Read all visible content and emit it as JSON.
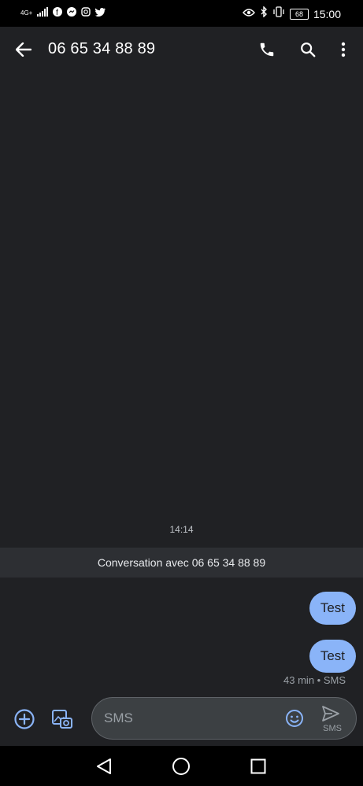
{
  "status_bar": {
    "network": "4G+",
    "time": "15:00",
    "battery": "68",
    "notification_icons": [
      "facebook-icon",
      "messenger-icon",
      "instagram-icon",
      "twitter-icon"
    ]
  },
  "app_bar": {
    "title": "06 65 34 88 89"
  },
  "conversation": {
    "timestamp": "14:14",
    "banner": "Conversation avec 06 65 34 88 89",
    "messages": [
      {
        "text": "Test"
      },
      {
        "text": "Test"
      }
    ],
    "meta": "43 min • SMS"
  },
  "composer": {
    "placeholder": "SMS",
    "send_label": "SMS"
  },
  "colors": {
    "background": "#202124",
    "bubble": "#8ab4f8",
    "accent": "#8ab4f8"
  }
}
